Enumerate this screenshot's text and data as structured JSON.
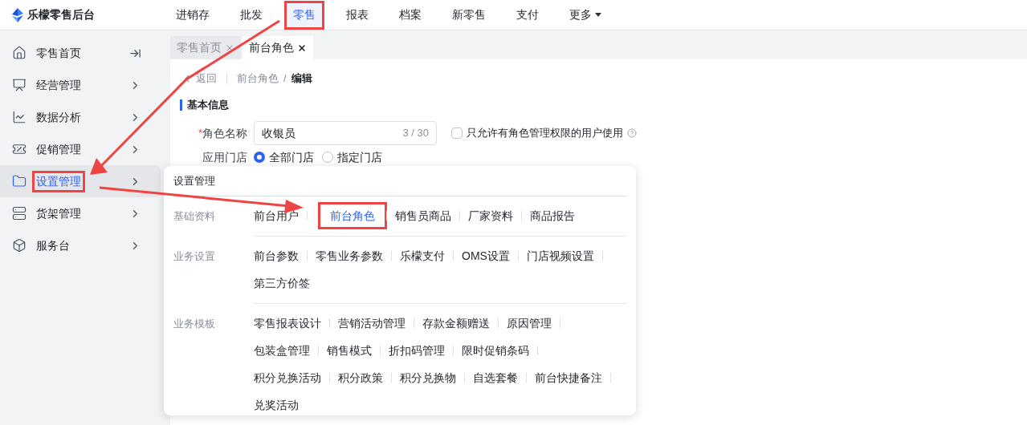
{
  "logo": {
    "title": "乐檬零售后台"
  },
  "top_nav": [
    {
      "label": "进销存",
      "selected": false,
      "highlighted": false,
      "kind": "link"
    },
    {
      "label": "批发",
      "selected": false,
      "highlighted": false,
      "kind": "link"
    },
    {
      "label": "零售",
      "selected": true,
      "highlighted": true,
      "kind": "link"
    },
    {
      "label": "报表",
      "selected": false,
      "highlighted": false,
      "kind": "link"
    },
    {
      "label": "档案",
      "selected": false,
      "highlighted": false,
      "kind": "link"
    },
    {
      "label": "新零售",
      "selected": false,
      "highlighted": false,
      "kind": "link"
    },
    {
      "label": "支付",
      "selected": false,
      "highlighted": false,
      "kind": "link"
    },
    {
      "label": "更多",
      "selected": false,
      "highlighted": false,
      "kind": "dropdown"
    }
  ],
  "sidebar": {
    "items": [
      {
        "label": "零售首页",
        "selected": false,
        "highlighted": false,
        "kind": "home"
      },
      {
        "label": "经营管理",
        "selected": false,
        "highlighted": false,
        "kind": "menu"
      },
      {
        "label": "数据分析",
        "selected": false,
        "highlighted": false,
        "kind": "menu"
      },
      {
        "label": "促销管理",
        "selected": false,
        "highlighted": false,
        "kind": "menu"
      },
      {
        "label": "设置管理",
        "selected": true,
        "highlighted": true,
        "kind": "menu"
      },
      {
        "label": "货架管理",
        "selected": false,
        "highlighted": false,
        "kind": "menu"
      },
      {
        "label": "服务台",
        "selected": false,
        "highlighted": false,
        "kind": "menu"
      }
    ]
  },
  "tabs": [
    {
      "label": "零售首页",
      "selected": false
    },
    {
      "label": "前台角色",
      "selected": true
    }
  ],
  "breadcrumb": {
    "back": "返回",
    "separator": "/",
    "path": [
      "前台角色",
      "编辑"
    ]
  },
  "section_title": "基本信息",
  "form": {
    "role_name": {
      "label": "角色名称",
      "required_mark": "*",
      "value": "收银员",
      "counter": "3 / 30"
    },
    "restrict": {
      "label": "只允许有角色管理权限的用户使用",
      "checked": false
    },
    "stores": {
      "label": "应用门店",
      "options": [
        {
          "label": "全部门店",
          "selected": true
        },
        {
          "label": "指定门店",
          "selected": false
        }
      ]
    }
  },
  "popup": {
    "title": "设置管理",
    "groups": [
      {
        "label": "基础资料",
        "items": [
          {
            "label": "前台用户",
            "selected": false,
            "highlighted": false
          },
          {
            "label": "前台角色",
            "selected": true,
            "highlighted": true
          },
          {
            "label": "销售员商品",
            "selected": false,
            "highlighted": false
          },
          {
            "label": "厂家资料",
            "selected": false,
            "highlighted": false
          },
          {
            "label": "商品报告",
            "selected": false,
            "highlighted": false
          }
        ]
      },
      {
        "label": "业务设置",
        "items": [
          {
            "label": "前台参数",
            "selected": false,
            "highlighted": false
          },
          {
            "label": "零售业务参数",
            "selected": false,
            "highlighted": false
          },
          {
            "label": "乐檬支付",
            "selected": false,
            "highlighted": false
          },
          {
            "label": "OMS设置",
            "selected": false,
            "highlighted": false
          },
          {
            "label": "门店视频设置",
            "selected": false,
            "highlighted": false
          },
          {
            "label": "第三方价签",
            "selected": false,
            "highlighted": false
          }
        ]
      },
      {
        "label": "业务模板",
        "items": [
          {
            "label": "零售报表设计",
            "selected": false,
            "highlighted": false
          },
          {
            "label": "营销活动管理",
            "selected": false,
            "highlighted": false
          },
          {
            "label": "存款金额赠送",
            "selected": false,
            "highlighted": false
          },
          {
            "label": "原因管理",
            "selected": false,
            "highlighted": false
          },
          {
            "label": "包装盒管理",
            "selected": false,
            "highlighted": false
          },
          {
            "label": "销售模式",
            "selected": false,
            "highlighted": false
          },
          {
            "label": "折扣码管理",
            "selected": false,
            "highlighted": false
          },
          {
            "label": "限时促销条码",
            "selected": false,
            "highlighted": false
          },
          {
            "label": "积分兑换活动",
            "selected": false,
            "highlighted": false
          },
          {
            "label": "积分政策",
            "selected": false,
            "highlighted": false
          },
          {
            "label": "积分兑换物",
            "selected": false,
            "highlighted": false
          },
          {
            "label": "自选套餐",
            "selected": false,
            "highlighted": false
          },
          {
            "label": "前台快捷备注",
            "selected": false,
            "highlighted": false
          },
          {
            "label": "兑奖活动",
            "selected": false,
            "highlighted": false
          }
        ]
      }
    ]
  }
}
